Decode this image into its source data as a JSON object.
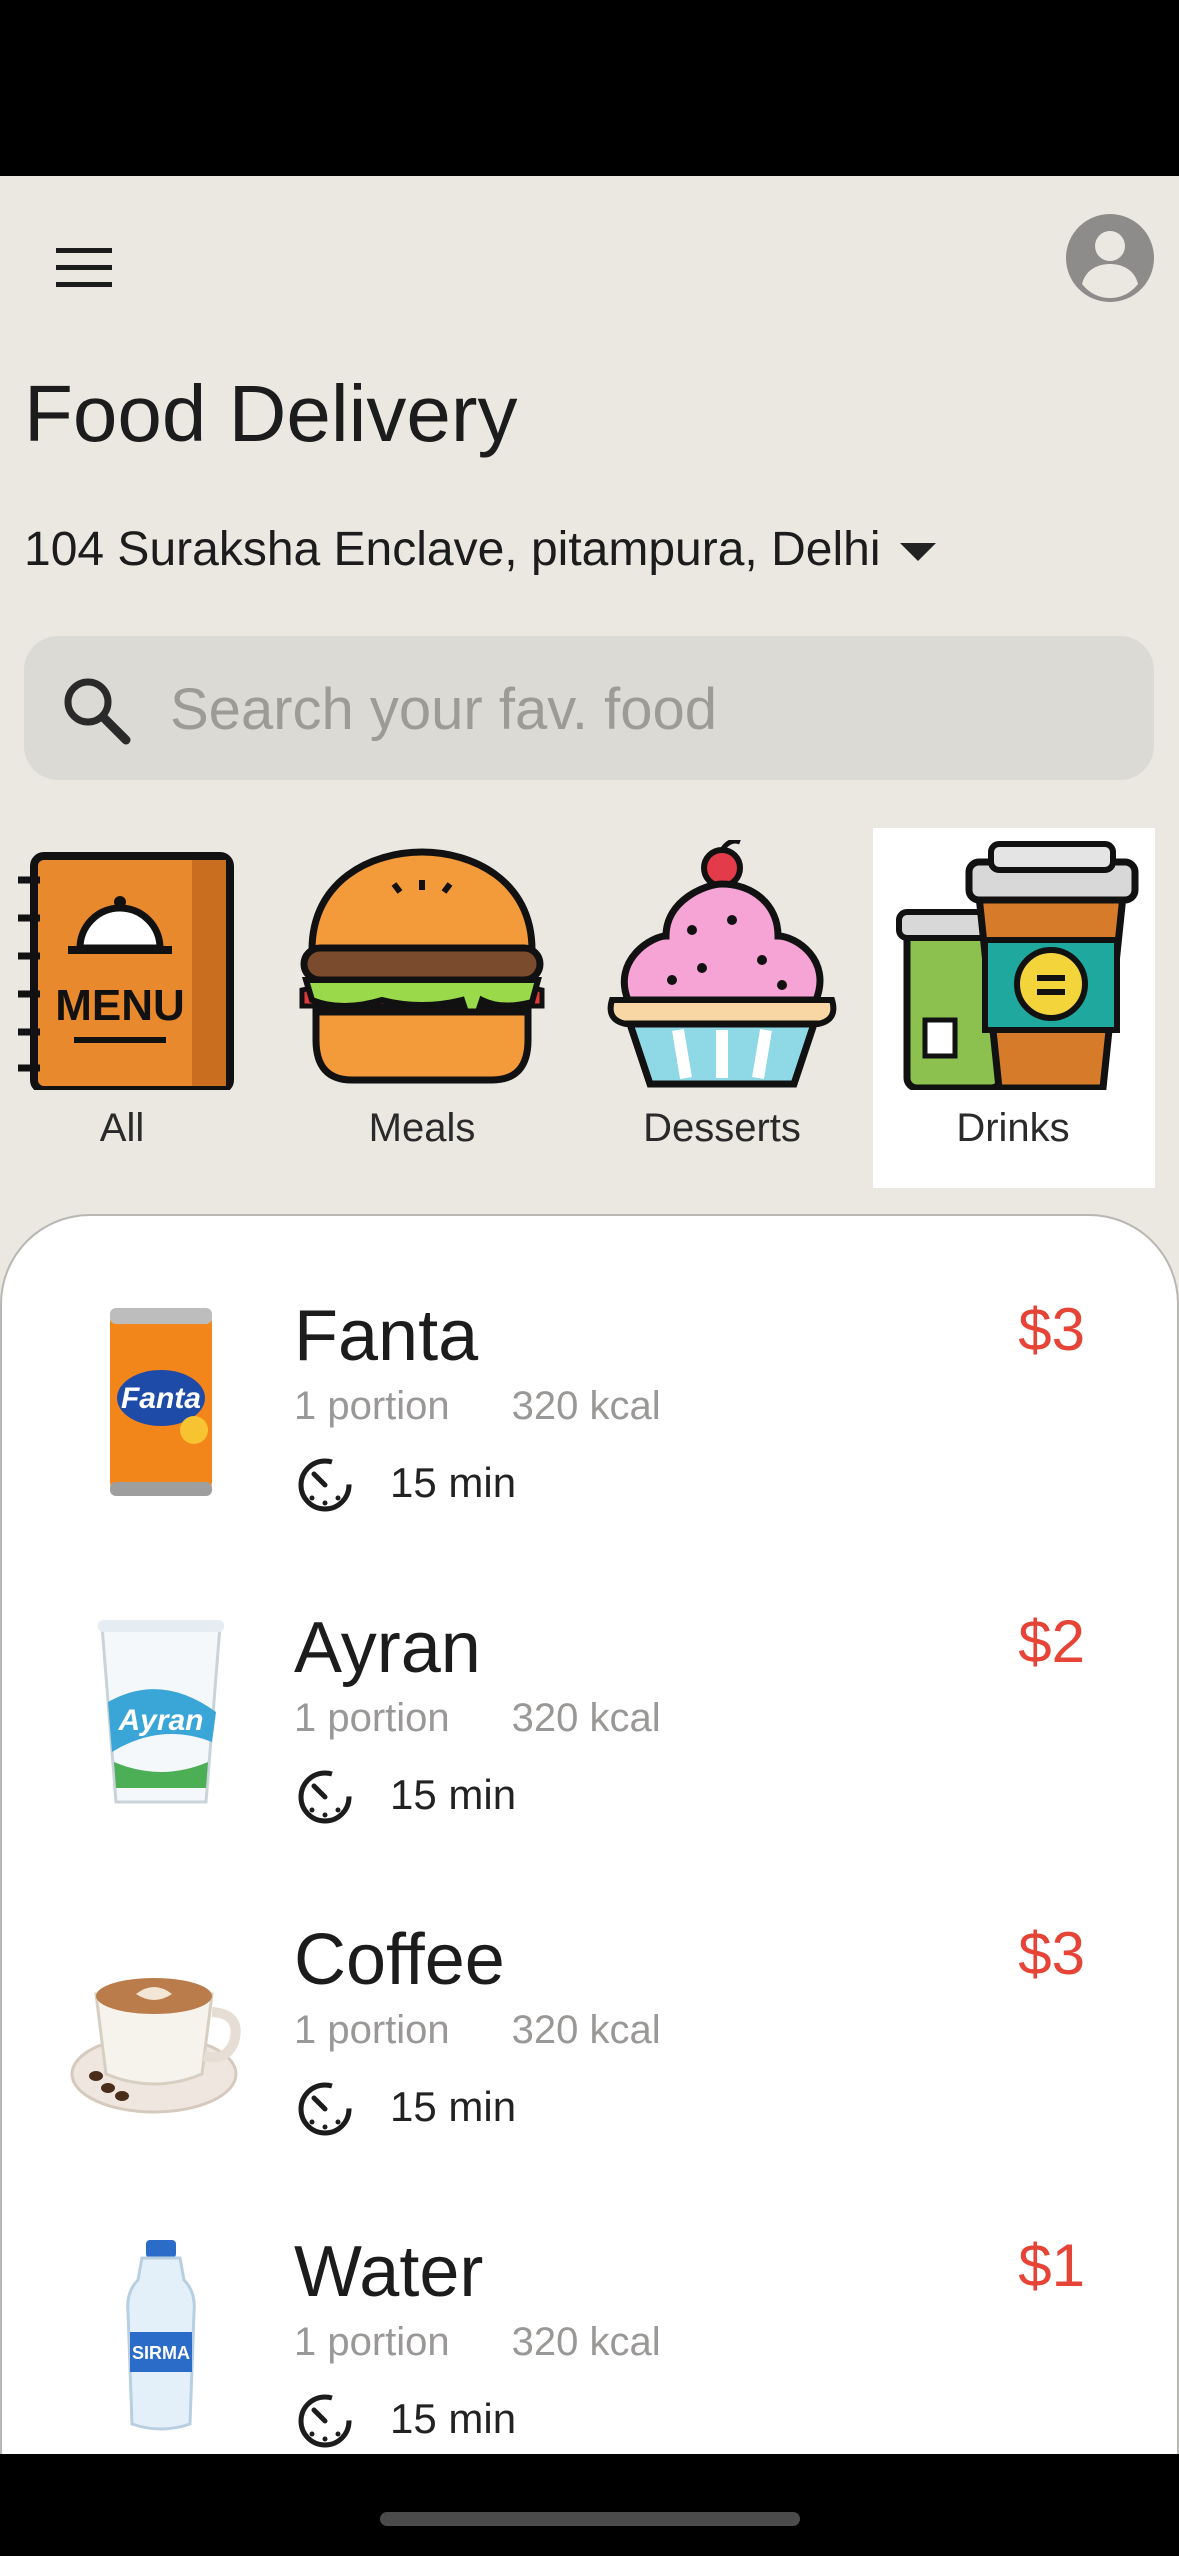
{
  "app": {
    "title": "Food Delivery"
  },
  "header": {
    "address": "104 Suraksha Enclave, pitampura, Delhi"
  },
  "search": {
    "placeholder": "Search your fav. food"
  },
  "categories": [
    {
      "label": "All",
      "icon": "menu-book-icon"
    },
    {
      "label": "Meals",
      "icon": "burger-icon"
    },
    {
      "label": "Desserts",
      "icon": "cupcake-icon"
    },
    {
      "label": "Drinks",
      "icon": "coffee-cups-icon",
      "selected": true
    }
  ],
  "items": [
    {
      "name": "Fanta",
      "portion": "1 portion",
      "kcal": "320 kcal",
      "time": "15 min",
      "price": "$3",
      "icon": "fanta-can-icon"
    },
    {
      "name": "Ayran",
      "portion": "1 portion",
      "kcal": "320 kcal",
      "time": "15 min",
      "price": "$2",
      "icon": "ayran-cup-icon"
    },
    {
      "name": "Coffee",
      "portion": "1 portion",
      "kcal": "320 kcal",
      "time": "15 min",
      "price": "$3",
      "icon": "coffee-cup-icon"
    },
    {
      "name": "Water",
      "portion": "1 portion",
      "kcal": "320 kcal",
      "time": "15 min",
      "price": "$1",
      "icon": "water-bottle-icon"
    }
  ],
  "colors": {
    "background": "#ebe8e2",
    "price": "#e54437",
    "search_bg": "#dcdad5"
  }
}
